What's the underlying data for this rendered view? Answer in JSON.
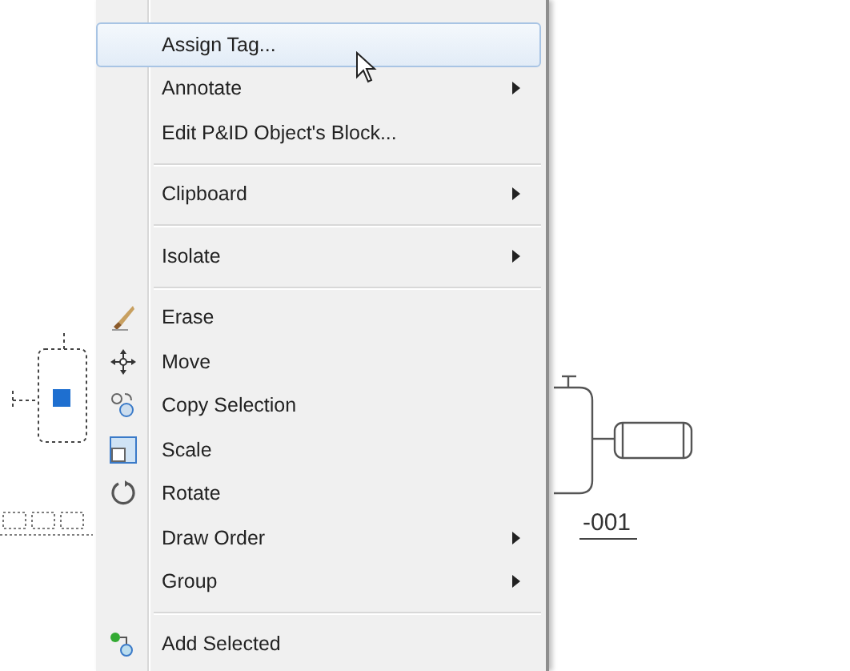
{
  "context_menu": {
    "groups": [
      {
        "items": [
          {
            "label": "Assign Tag...",
            "selected": true,
            "submenu": false
          },
          {
            "label": "Annotate",
            "selected": false,
            "submenu": true
          },
          {
            "label": "Edit P&ID Object's Block...",
            "selected": false,
            "submenu": false
          }
        ]
      },
      {
        "items": [
          {
            "label": "Clipboard",
            "selected": false,
            "submenu": true
          }
        ]
      },
      {
        "items": [
          {
            "label": "Isolate",
            "selected": false,
            "submenu": true
          }
        ]
      },
      {
        "items": [
          {
            "label": "Erase",
            "selected": false,
            "submenu": false
          },
          {
            "label": "Move",
            "selected": false,
            "submenu": false
          },
          {
            "label": "Copy Selection",
            "selected": false,
            "submenu": false
          },
          {
            "label": "Scale",
            "selected": false,
            "submenu": false
          },
          {
            "label": "Rotate",
            "selected": false,
            "submenu": false
          },
          {
            "label": "Draw Order",
            "selected": false,
            "submenu": true
          },
          {
            "label": "Group",
            "selected": false,
            "submenu": true
          }
        ]
      },
      {
        "items": [
          {
            "label": "Add Selected",
            "selected": false,
            "submenu": false
          }
        ]
      }
    ]
  },
  "canvas": {
    "tag_label": "-001"
  }
}
